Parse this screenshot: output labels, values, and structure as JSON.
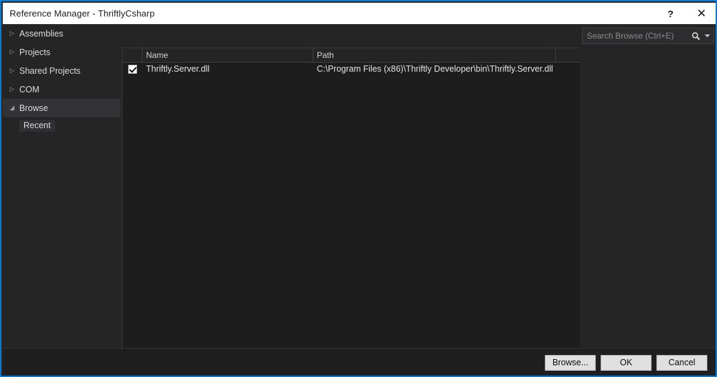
{
  "window": {
    "title": "Reference Manager - ThriftlyCsharp",
    "accent_color": "#0a7bd4",
    "titlebar_bg": "#ffffff",
    "body_bg": "#252526",
    "help_label": "?",
    "close_label": "✕"
  },
  "sidebar": {
    "items": [
      {
        "label": "Assemblies",
        "arrow": "▷",
        "selected": false
      },
      {
        "label": "Projects",
        "arrow": "▷",
        "selected": false
      },
      {
        "label": "Shared Projects",
        "arrow": "▷",
        "selected": false
      },
      {
        "label": "COM",
        "arrow": "▷",
        "selected": false
      },
      {
        "label": "Browse",
        "arrow": "◢",
        "selected": true
      }
    ],
    "subitem": {
      "label": "Recent"
    }
  },
  "search": {
    "placeholder": "Search Browse (Ctrl+E)",
    "value": "",
    "icon": "search-icon",
    "dropdown_icon": "chevron-down-icon"
  },
  "list": {
    "columns": [
      {
        "key": "check",
        "label": ""
      },
      {
        "key": "name",
        "label": "Name"
      },
      {
        "key": "path",
        "label": "Path"
      },
      {
        "key": "extra",
        "label": ""
      }
    ],
    "rows": [
      {
        "checked": true,
        "name": "Thriftly.Server.dll",
        "path": "C:\\Program Files (x86)\\Thriftly Developer\\bin\\Thriftly.Server.dll"
      }
    ]
  },
  "footer": {
    "browse_label": "Browse...",
    "ok_label": "OK",
    "cancel_label": "Cancel"
  }
}
